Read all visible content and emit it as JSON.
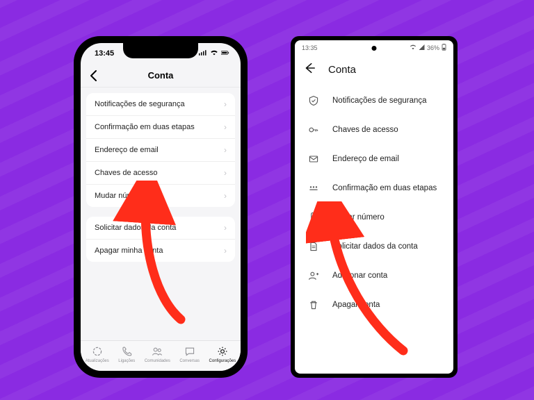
{
  "ios": {
    "time": "13:45",
    "title": "Conta",
    "group1": [
      "Notificações de segurança",
      "Confirmação em duas etapas",
      "Endereço de email",
      "Chaves de acesso",
      "Mudar número"
    ],
    "group2": [
      "Solicitar dados da conta",
      "Apagar minha conta"
    ],
    "tabs": [
      {
        "label": "Atualizações"
      },
      {
        "label": "Ligações"
      },
      {
        "label": "Comunidades"
      },
      {
        "label": "Conversas"
      },
      {
        "label": "Configurações"
      }
    ]
  },
  "android": {
    "time": "13:35",
    "battery": "36%",
    "title": "Conta",
    "items": [
      "Notificações de segurança",
      "Chaves de acesso",
      "Endereço de email",
      "Confirmação em duas etapas",
      "Mudar número",
      "Solicitar dados da conta",
      "Adicionar conta",
      "Apagar conta"
    ]
  },
  "colors": {
    "arrow": "#ff2d1a"
  }
}
